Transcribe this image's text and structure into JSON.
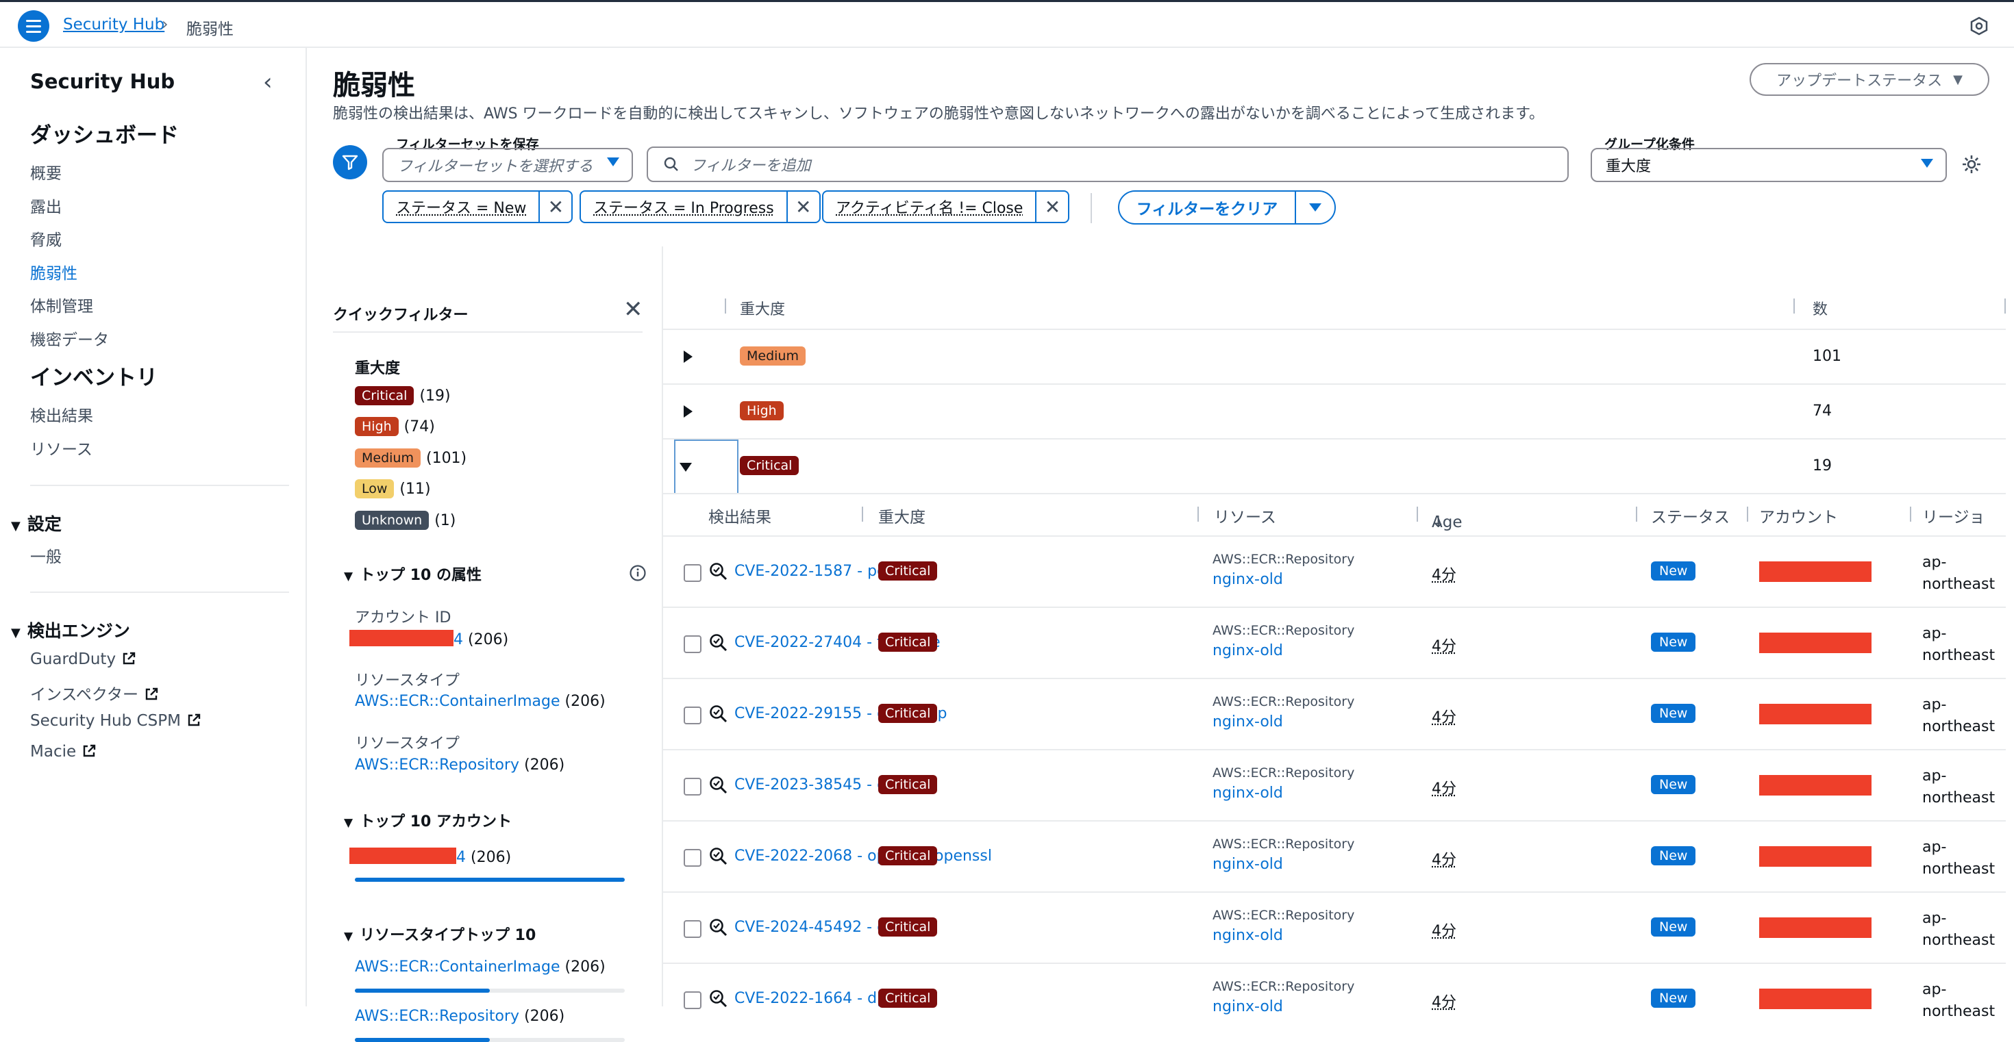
{
  "topbar": {
    "breadcrumb_root": "Security Hub",
    "breadcrumb_current": "脆弱性"
  },
  "sidebar": {
    "title": "Security Hub",
    "dashboard_heading": "ダッシュボード",
    "dashboard_items": [
      "概要",
      "露出",
      "脅威",
      "脆弱性",
      "体制管理",
      "機密データ"
    ],
    "active_item": "脆弱性",
    "inventory_heading": "インベントリ",
    "inventory_items": [
      "検出結果",
      "リソース"
    ],
    "settings_group": "設定",
    "settings_items": [
      "一般"
    ],
    "engines_group": "検出エンジン",
    "engine_items": [
      "GuardDuty",
      "インスペクター",
      "Security Hub CSPM",
      "Macie"
    ]
  },
  "page": {
    "title": "脆弱性",
    "description": "脆弱性の検出結果は、AWS ワークロードを自動的に検出してスキャンし、ソフトウェアの脆弱性や意図しないネットワークへの露出がないかを調べることによって生成されます。",
    "update_status_button": "アップデートステータス"
  },
  "filters": {
    "filter_set_label": "フィルターセットを保存",
    "filter_set_placeholder": "フィルターセットを選択する",
    "search_placeholder": "フィルターを追加",
    "group_by_label": "グループ化条件",
    "group_by_value": "重大度",
    "tokens": [
      "ステータス = New",
      "ステータス = In Progress",
      "アクティビティ名 != Close"
    ],
    "clear_button": "フィルターをクリア"
  },
  "quick_filters": {
    "title": "クイックフィルター",
    "severity_heading": "重大度",
    "severities": [
      {
        "label": "Critical",
        "count": "(19)"
      },
      {
        "label": "High",
        "count": "(74)"
      },
      {
        "label": "Medium",
        "count": "(101)"
      },
      {
        "label": "Low",
        "count": "(11)"
      },
      {
        "label": "Unknown",
        "count": "(1)"
      }
    ],
    "top_attributes_heading": "トップ 10 の属性",
    "account_id_label": "アカウント ID",
    "account_id_suffix": "4",
    "account_id_count": "(206)",
    "resource_type_label_1": "リソースタイプ",
    "resource_type_value_1": "AWS::ECR::ContainerImage",
    "resource_type_count_1": "(206)",
    "resource_type_label_2": "リソースタイプ",
    "resource_type_value_2": "AWS::ECR::Repository",
    "resource_type_count_2": "(206)",
    "top_accounts_heading": "トップ 10 アカウント",
    "top_account_suffix": "4",
    "top_account_count": "(206)",
    "top_account_fraction": 1.0,
    "resource_types_heading": "リソースタイプトップ 10",
    "rt_items": [
      {
        "label": "AWS::ECR::ContainerImage",
        "count": "(206)",
        "fraction": 0.5
      },
      {
        "label": "AWS::ECR::Repository",
        "count": "(206)",
        "fraction": 0.5
      }
    ]
  },
  "table": {
    "header_severity": "重大度",
    "header_count": "数",
    "groups": [
      {
        "severity": "Medium",
        "count": "101",
        "expanded": false
      },
      {
        "severity": "High",
        "count": "74",
        "expanded": false
      },
      {
        "severity": "Critical",
        "count": "19",
        "expanded": true
      }
    ],
    "sub_headers": {
      "finding": "検出結果",
      "severity": "重大度",
      "resource": "リソース",
      "age": "Age",
      "status": "ステータス",
      "account": "アカウント",
      "region": "リージョ"
    },
    "findings": [
      {
        "title": "CVE-2022-1587 - pcre2",
        "severity": "Critical",
        "resource_type": "AWS::ECR::Repository",
        "resource_name": "nginx-old",
        "age": "4分",
        "status": "New",
        "region": "ap-\nnortheast"
      },
      {
        "title": "CVE-2022-27404 - freetype",
        "severity": "Critical",
        "resource_type": "AWS::ECR::Repository",
        "resource_name": "nginx-old",
        "age": "4分",
        "status": "New",
        "region": "ap-\nnortheast"
      },
      {
        "title": "CVE-2022-29155 - openldap",
        "severity": "Critical",
        "resource_type": "AWS::ECR::Repository",
        "resource_name": "nginx-old",
        "age": "4分",
        "status": "New",
        "region": "ap-\nnortheast"
      },
      {
        "title": "CVE-2023-38545 - curl",
        "severity": "Critical",
        "resource_type": "AWS::ECR::Repository",
        "resource_name": "nginx-old",
        "age": "4分",
        "status": "New",
        "region": "ap-\nnortheast"
      },
      {
        "title": "CVE-2022-2068 - openssl, openssl",
        "severity": "Critical",
        "resource_type": "AWS::ECR::Repository",
        "resource_name": "nginx-old",
        "age": "4分",
        "status": "New",
        "region": "ap-\nnortheast"
      },
      {
        "title": "CVE-2024-45492 - expat",
        "severity": "Critical",
        "resource_type": "AWS::ECR::Repository",
        "resource_name": "nginx-old",
        "age": "4分",
        "status": "New",
        "region": "ap-\nnortheast"
      },
      {
        "title": "CVE-2022-1664 - dpkg",
        "severity": "Critical",
        "resource_type": "AWS::ECR::Repository",
        "resource_name": "nginx-old",
        "age": "4分",
        "status": "New",
        "region": "ap-\nnortheast"
      }
    ]
  },
  "colors": {
    "accent": "#0972d3",
    "critical": "#7d0c0c",
    "high": "#c13c1c",
    "medium": "#f0925c",
    "low": "#f2cf6b",
    "unknown": "#414d5c",
    "redaction": "#ee3f2a"
  },
  "icons": [
    "menu-icon",
    "chevron-right-icon",
    "notification-icon",
    "chevron-left-icon",
    "external-link-icon",
    "filter-icon",
    "search-icon",
    "settings-icon",
    "close-icon",
    "info-icon",
    "sort-down-icon",
    "finding-icon",
    "caret-down-icon",
    "caret-right-icon"
  ]
}
